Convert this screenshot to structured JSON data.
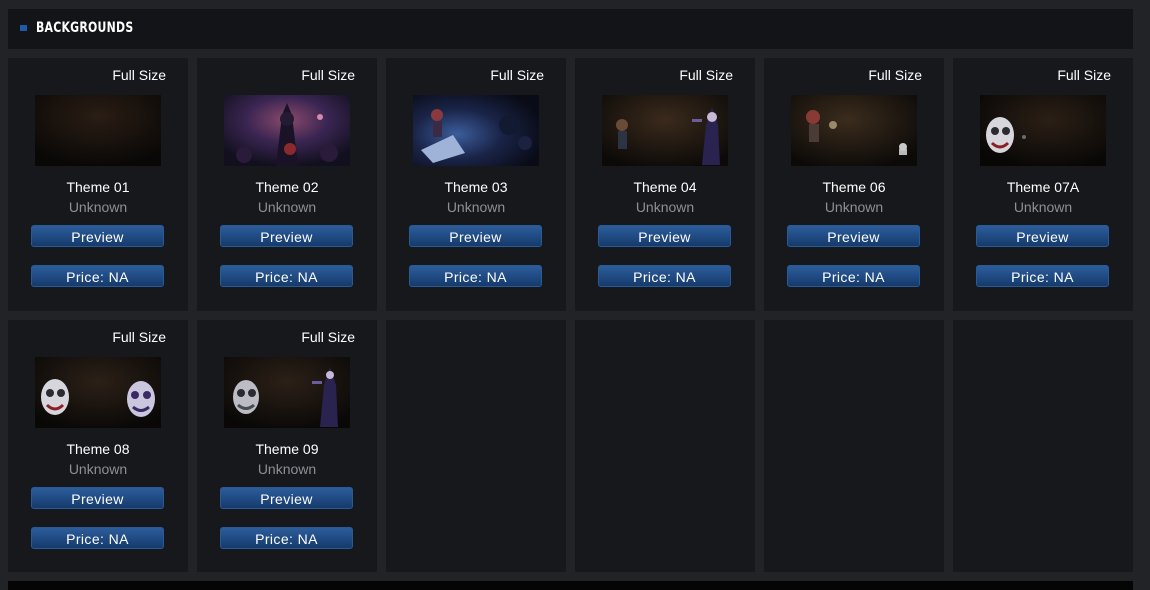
{
  "section": {
    "title": "BACKGROUNDS"
  },
  "labels": {
    "full_size": "Full Size",
    "preview": "Preview",
    "price": "Price: NA"
  },
  "themes": [
    {
      "name": "Theme 01",
      "artist": "Unknown"
    },
    {
      "name": "Theme 02",
      "artist": "Unknown"
    },
    {
      "name": "Theme 03",
      "artist": "Unknown"
    },
    {
      "name": "Theme 04",
      "artist": "Unknown"
    },
    {
      "name": "Theme 06",
      "artist": "Unknown"
    },
    {
      "name": "Theme 07A",
      "artist": "Unknown"
    },
    {
      "name": "Theme 08",
      "artist": "Unknown"
    },
    {
      "name": "Theme 09",
      "artist": "Unknown"
    }
  ],
  "colors": {
    "page_bg": "#222327",
    "card_bg": "#17181c",
    "header_bg": "#131417",
    "button_blue": "#1e4a85",
    "accent_square": "#1e5aa8"
  }
}
